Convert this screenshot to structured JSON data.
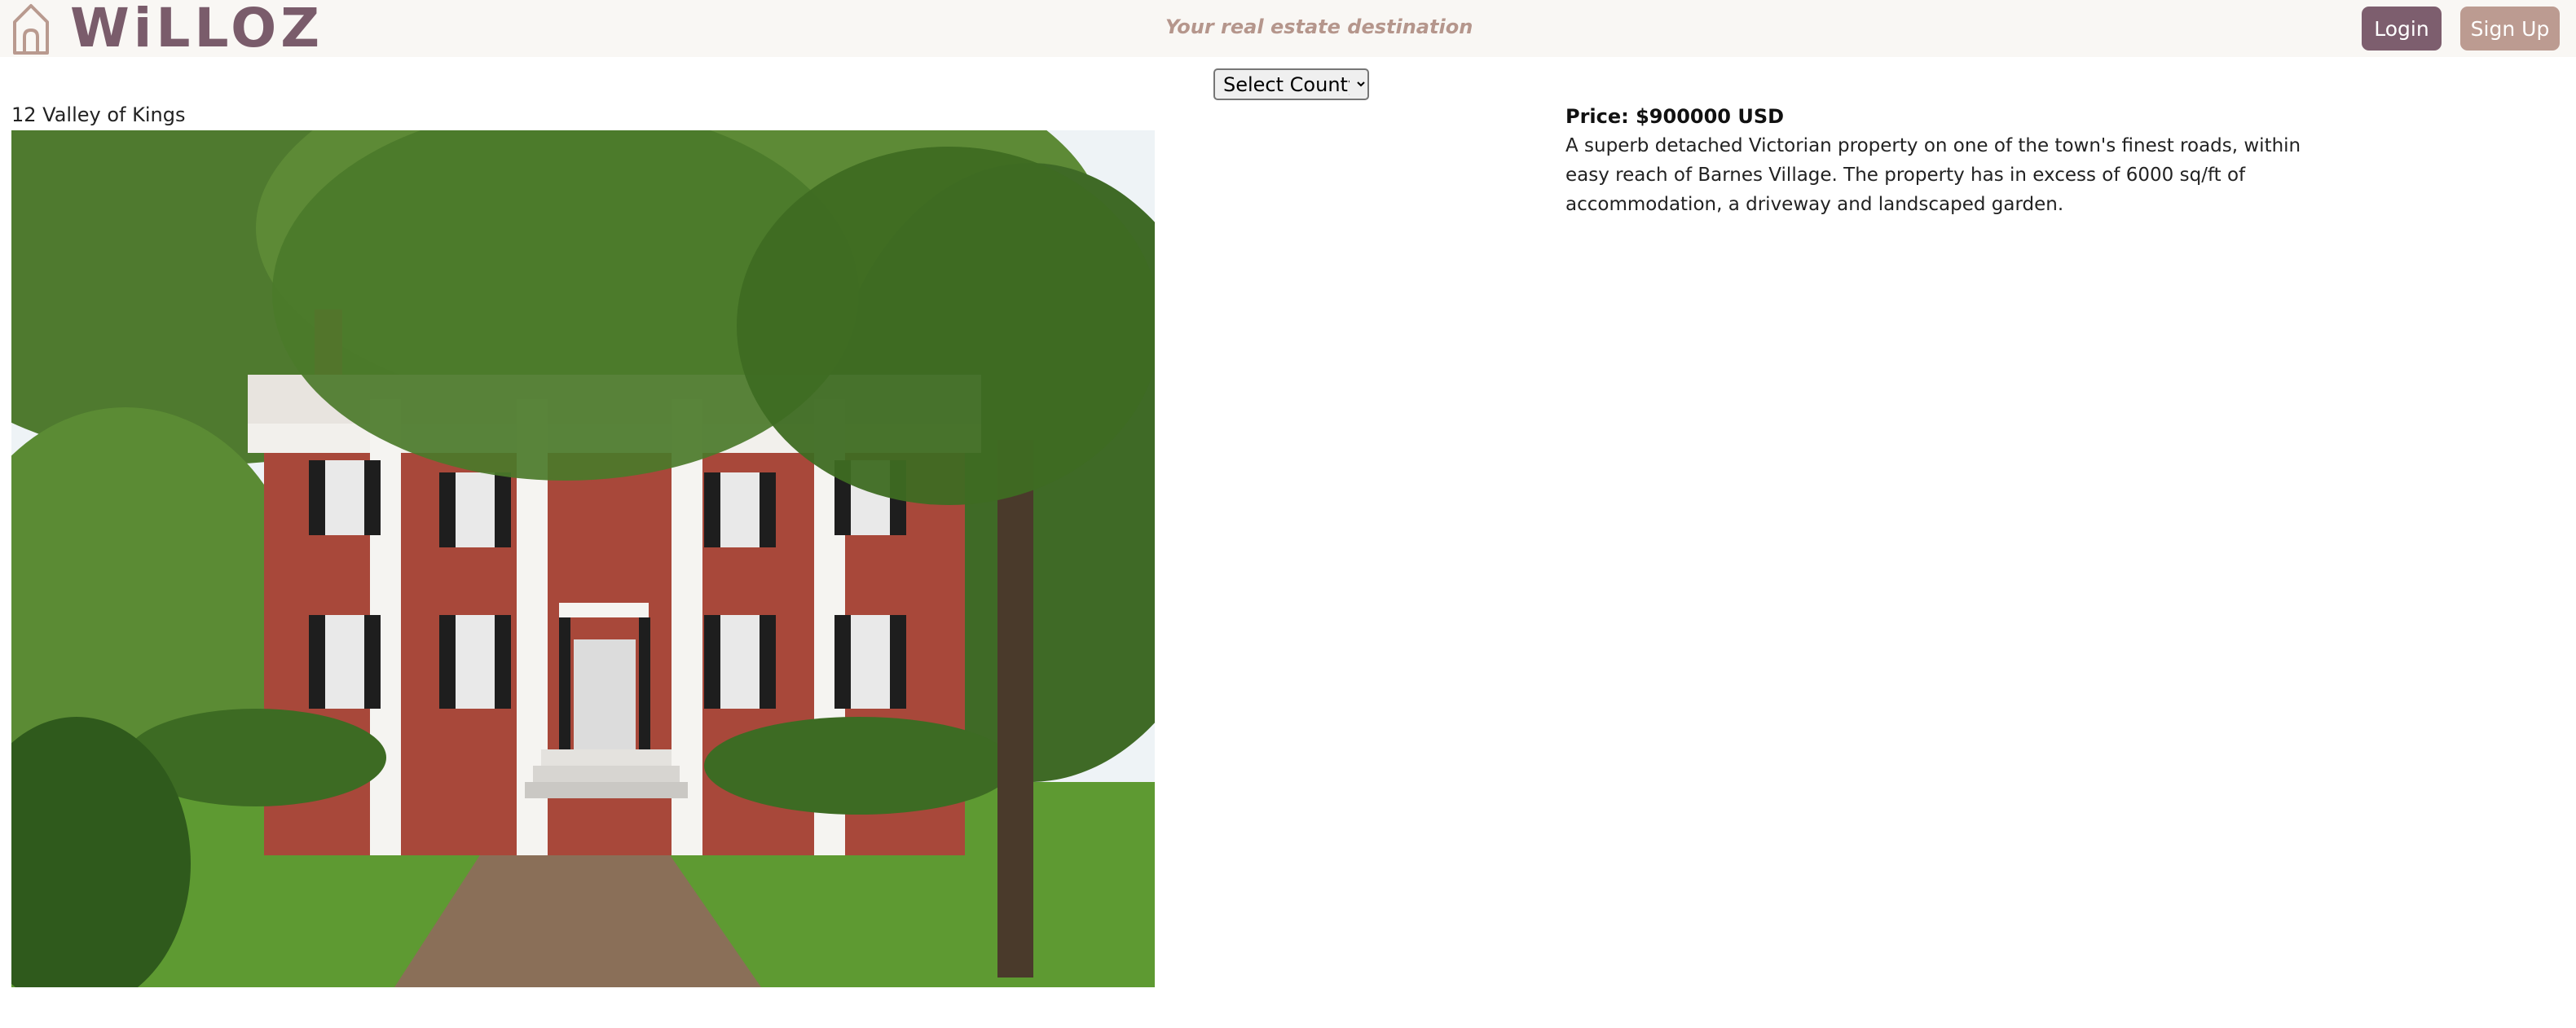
{
  "header": {
    "logo_text": "WiLLOZ",
    "tagline": "Your real estate destination",
    "login_label": "Login",
    "signup_label": "Sign Up",
    "colors": {
      "brand": "#7a5c6b",
      "login_bg": "#7d5e6e",
      "signup_bg": "#bc9b91",
      "header_bg": "#f9f7f4"
    }
  },
  "filter": {
    "county_selected": "Select County"
  },
  "listing": {
    "address": "12 Valley of Kings",
    "price": "Price: $900000 USD",
    "description": "A superb detached Victorian property on one of the town's finest roads, within easy reach of Barnes Village. The property has in excess of 6000 sq/ft of accommodation, a driveway and landscaped garden.",
    "icons": {
      "logo": "house-icon"
    }
  }
}
